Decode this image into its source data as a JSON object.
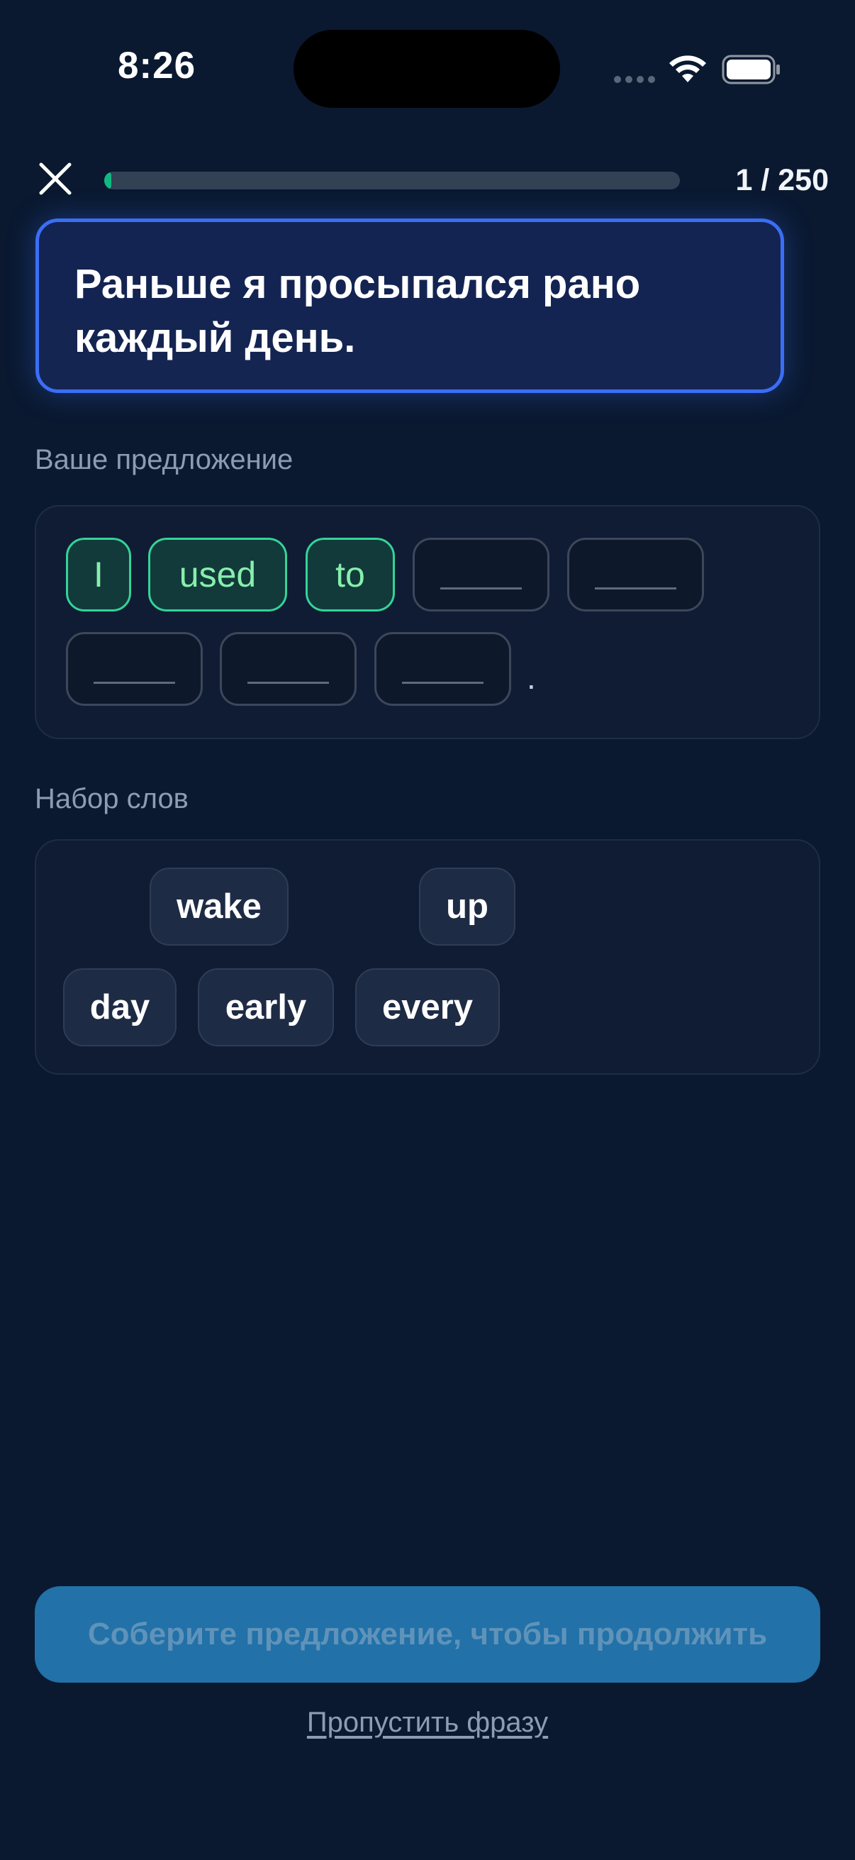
{
  "status_bar": {
    "time": "8:26"
  },
  "header": {
    "close_icon": "close-icon",
    "progress_fraction": 0.004,
    "progress_text": "1 / 250"
  },
  "prompt": {
    "text": "Раньше я просыпался рано каждый день."
  },
  "answer": {
    "label": "Ваше предложение",
    "filled_words": [
      "I",
      "used",
      "to"
    ],
    "empty_slot_count": 5,
    "terminal_punctuation": "."
  },
  "word_bank": {
    "label": "Набор слов",
    "words": [
      "wake",
      "up",
      "day",
      "early",
      "every"
    ]
  },
  "footer": {
    "continue_label": "Соберите предложение, чтобы продолжить",
    "skip_label": "Пропустить фразу"
  },
  "colors": {
    "background": "#0a1930",
    "accent_blue": "#3b6ef5",
    "filled_green": "#34d399",
    "button_disabled": "#2271a8"
  }
}
